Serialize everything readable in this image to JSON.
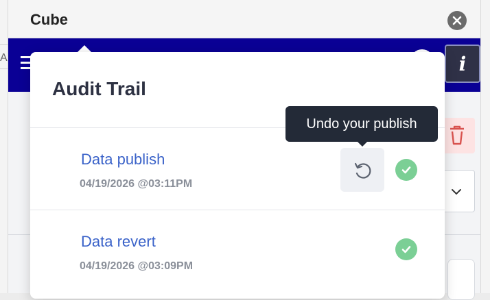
{
  "window": {
    "title": "Cube"
  },
  "background": {
    "left_letter": "A"
  },
  "navbar": {
    "info_label": "i"
  },
  "audit_trail": {
    "title": "Audit Trail",
    "tooltip": "Undo your publish",
    "entries": [
      {
        "title": "Data publish",
        "timestamp": "04/19/2026 @03:11PM",
        "status": "success",
        "undoable": true
      },
      {
        "title": "Data revert",
        "timestamp": "04/19/2026 @03:09PM",
        "status": "success",
        "undoable": false
      }
    ]
  },
  "colors": {
    "navbar": "#0a0095",
    "link": "#3b63c9",
    "success": "#7bcf95",
    "tooltip": "#232a37"
  },
  "icons": {
    "close": "close-icon",
    "menu": "hamburger-menu-icon",
    "info": "info-icon",
    "undo": "undo-icon",
    "status": "check-circle-icon"
  }
}
